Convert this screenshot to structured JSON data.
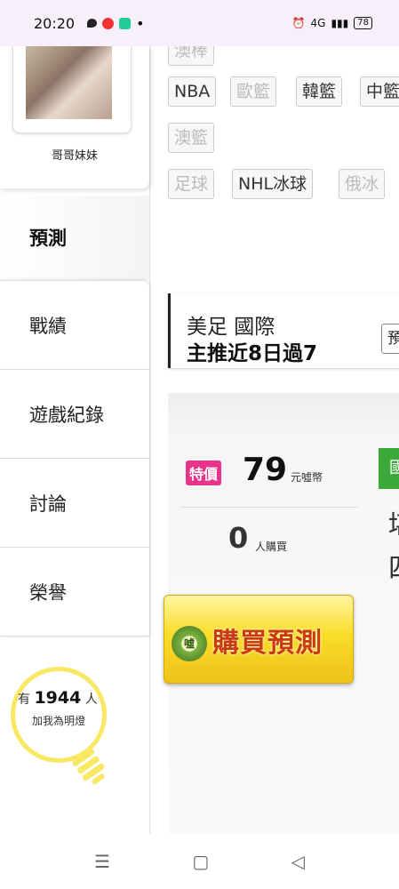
{
  "status": {
    "time": "20:20",
    "net": "4G",
    "battery": "78"
  },
  "profile": {
    "nickname": "哥哥妹妹"
  },
  "sidebar": {
    "active": "預測",
    "items": [
      {
        "label": "戰績"
      },
      {
        "label": "遊戲紀錄"
      },
      {
        "label": "討論"
      },
      {
        "label": "榮譽"
      }
    ]
  },
  "fans": {
    "prefix": "有",
    "count": "1944",
    "suffix": "人",
    "caption": "加我為明燈"
  },
  "tags": {
    "top_partial": "澳棒",
    "row1": [
      "NBA",
      "歐籃",
      "韓籃",
      "中籃"
    ],
    "row2": [
      "澳籃"
    ],
    "row3": [
      "足球",
      "NHL冰球",
      "俄冰"
    ]
  },
  "card": {
    "title": "美足 國際",
    "subtitle": "主推近8日過7",
    "button": "預"
  },
  "purchase": {
    "badge": "特價",
    "price": "79",
    "price_unit": "元噓幣",
    "buyers": "0",
    "buyers_unit": "人購買",
    "green_tag": "國際",
    "chars": [
      "堪",
      "四"
    ],
    "button": "購買預測",
    "coin": "噓"
  },
  "nav": {
    "menu": "☰",
    "home": "▢",
    "back": "◁"
  }
}
